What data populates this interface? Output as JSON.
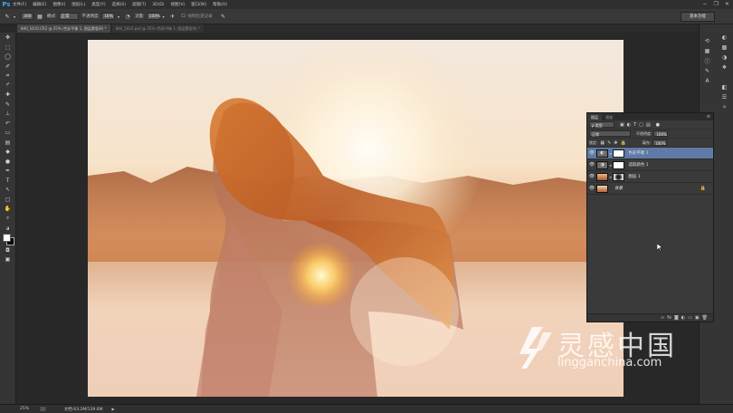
{
  "app": {
    "logo": "Ps"
  },
  "menu": [
    "文件(F)",
    "编辑(E)",
    "图像(I)",
    "图层(L)",
    "类型(Y)",
    "选择(S)",
    "滤镜(T)",
    "3D(D)",
    "视图(V)",
    "窗口(W)",
    "帮助(H)"
  ],
  "window_controls": [
    "−",
    "❐",
    "✕"
  ],
  "options": {
    "brush_size": "300",
    "mode_label": "模式:",
    "mode_value": "正常",
    "opacity_label": "不透明度:",
    "opacity_value": "18%",
    "flow_label": "流量:",
    "flow_value": "100%",
    "history_label": "绘制历史记录"
  },
  "workspace": "基本功能",
  "doc_tabs": [
    {
      "label": "840_5410.CR2 @ 25% (色彩平衡 1, 图层蒙版/8) *",
      "active": true
    },
    {
      "label": "840_5410.psd @ 25% (色彩平衡 1, 图层蒙版/8) *",
      "active": false
    }
  ],
  "layers_panel": {
    "tabs": [
      "图层",
      "通道"
    ],
    "kind_filter": "ρ 类型",
    "blend_mode": "正常",
    "opacity_label": "不透明度:",
    "opacity_value": "100%",
    "lock_label": "锁定:",
    "fill_label": "填充:",
    "fill_value": "100%",
    "layers": [
      {
        "name": "色彩平衡 1",
        "selected": true
      },
      {
        "name": "选取颜色 1",
        "selected": false
      },
      {
        "name": "图层 1",
        "selected": false
      },
      {
        "name": "背景",
        "selected": false
      }
    ],
    "footer_icons": [
      "link-icon",
      "fx-icon",
      "mask-icon",
      "adjustment-icon",
      "group-icon",
      "new-layer-icon",
      "trash-icon"
    ]
  },
  "status": {
    "zoom": "25%",
    "doc_label": "文档:63.2M/139.6M"
  },
  "watermark": {
    "cn": "灵感中国",
    "url": "lingganchina.com"
  },
  "colors": {
    "accent": "#5f7aa6",
    "ps_blue": "#31a8ff"
  }
}
